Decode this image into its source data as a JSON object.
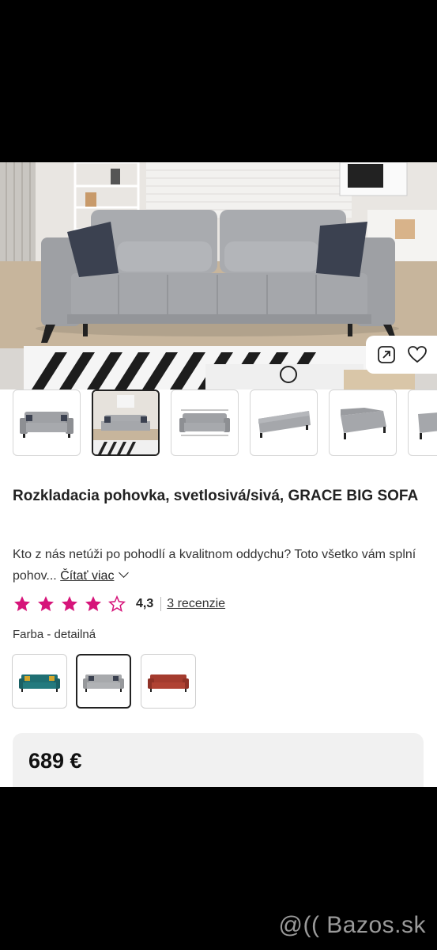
{
  "product": {
    "title": "Rozkladacia pohovka, svetlosivá/sivá, GRACE BIG SOFA",
    "description_text": "Kto z nás netúži po pohodlí a kvalitnom oddychu? Toto všetko vám splní pohov...",
    "read_more_label": "Čítať viac",
    "rating_value": "4,3",
    "rating_stars": 4.3,
    "reviews_label": "3 recenzie",
    "color_label": "Farba - detailná",
    "price": "689 €"
  },
  "gallery": {
    "thumbnails": [
      "sofa-front",
      "sofa-room",
      "sofa-dimensions",
      "sofa-bed-open",
      "sofa-side",
      "sofa-partial"
    ],
    "selected_index": 1
  },
  "colors": {
    "options": [
      "teal",
      "light-gray",
      "rust-red"
    ],
    "selected_index": 1,
    "hex": {
      "teal": "#1f6f73",
      "light-gray": "#a7a9ac",
      "rust-red": "#a43b2e"
    }
  },
  "accent_color": "#d6157a",
  "watermark": "@(( Bazos.sk"
}
